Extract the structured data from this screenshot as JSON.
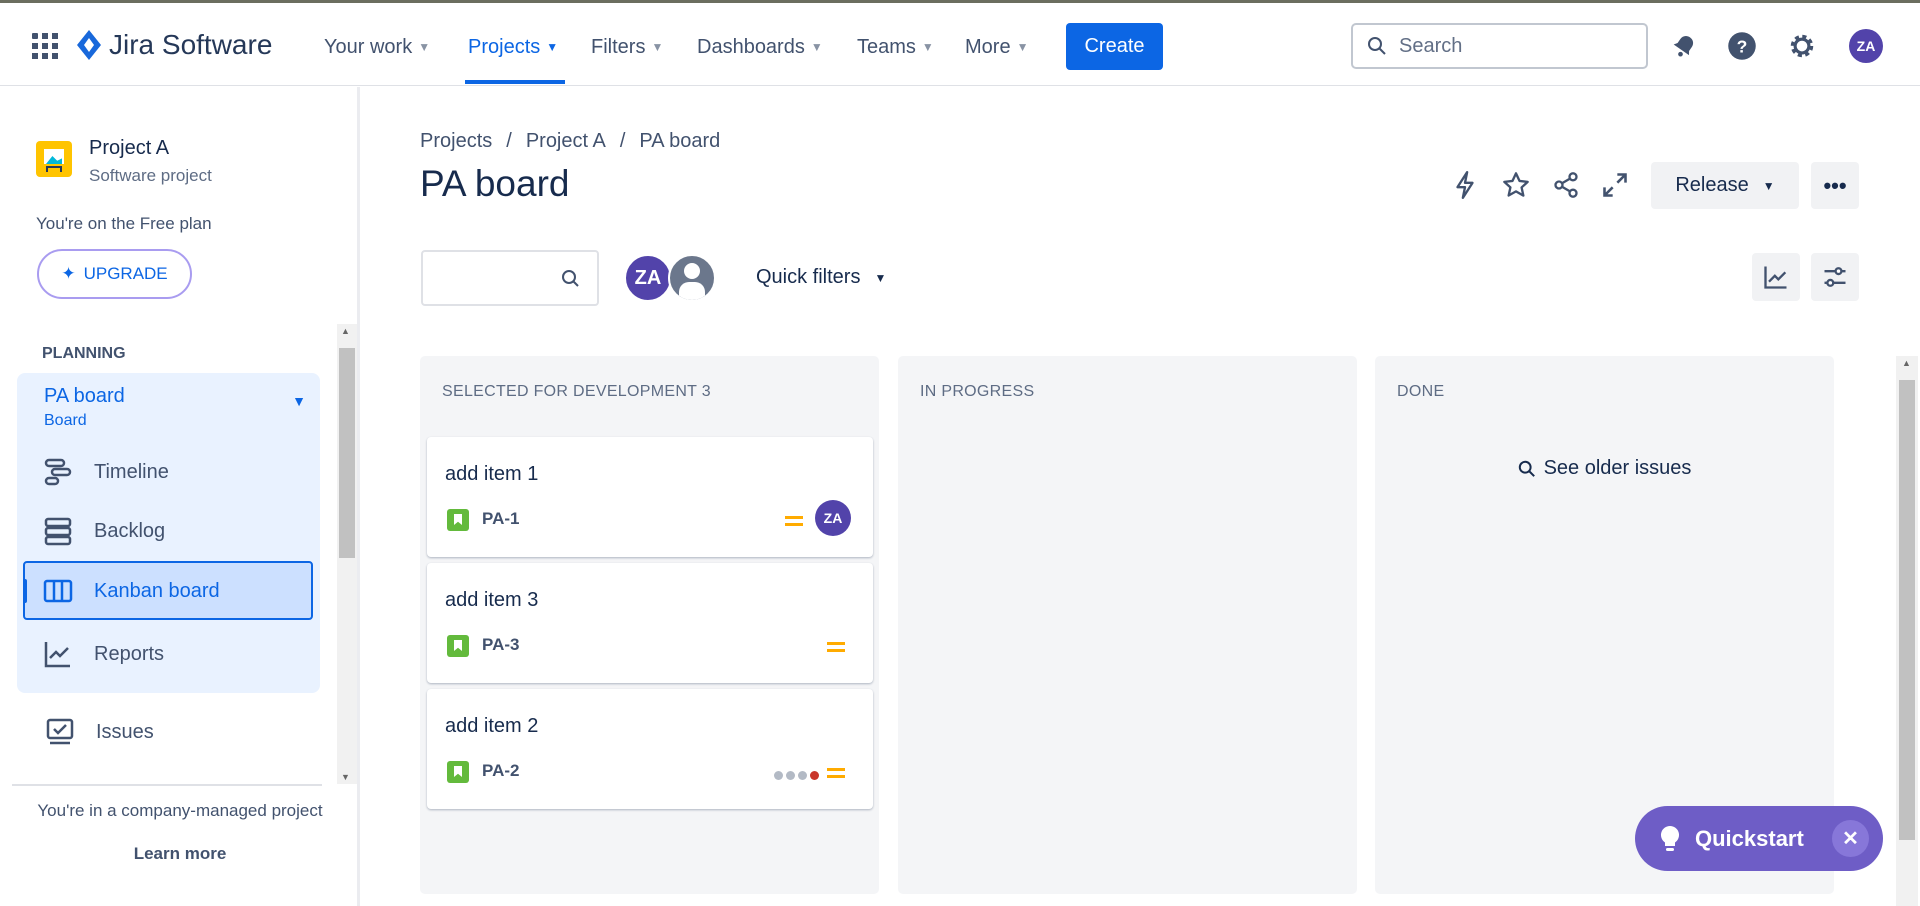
{
  "header": {
    "app_name": "Jira Software",
    "nav": [
      {
        "label": "Your work"
      },
      {
        "label": "Projects",
        "active": true
      },
      {
        "label": "Filters"
      },
      {
        "label": "Dashboards"
      },
      {
        "label": "Teams"
      },
      {
        "label": "More"
      }
    ],
    "create_label": "Create",
    "search_placeholder": "Search",
    "user_initials": "ZA"
  },
  "sidebar": {
    "project_name": "Project A",
    "project_type": "Software project",
    "plan_text": "You're on the Free plan",
    "upgrade_label": "UPGRADE",
    "section_label": "PLANNING",
    "board": {
      "label": "PA board",
      "sub": "Board"
    },
    "items": [
      {
        "label": "Timeline"
      },
      {
        "label": "Backlog"
      },
      {
        "label": "Kanban board",
        "selected": true
      },
      {
        "label": "Reports"
      },
      {
        "label": "Issues"
      }
    ],
    "footer_text": "You're in a company-managed project",
    "learn_more": "Learn more"
  },
  "main": {
    "breadcrumb": [
      "Projects",
      "Project A",
      "PA board"
    ],
    "title": "PA board",
    "release_label": "Release",
    "quick_filters_label": "Quick filters",
    "avatar_initials": "ZA",
    "columns": [
      {
        "title": "SELECTED FOR DEVELOPMENT 3",
        "cards": [
          {
            "title": "add item 1",
            "key": "PA-1",
            "assignee": "ZA"
          },
          {
            "title": "add item 3",
            "key": "PA-3"
          },
          {
            "title": "add item 2",
            "key": "PA-2"
          }
        ]
      },
      {
        "title": "IN PROGRESS",
        "cards": []
      },
      {
        "title": "DONE",
        "cards": [],
        "see_older": "See older issues"
      }
    ]
  },
  "quickstart": {
    "label": "Quickstart"
  },
  "colors": {
    "brand": "#0c66e4",
    "avatar": "#5243aa",
    "story": "#63ba3c",
    "priority_medium": "#ffab00",
    "quickstart": "#6e5dc6"
  }
}
